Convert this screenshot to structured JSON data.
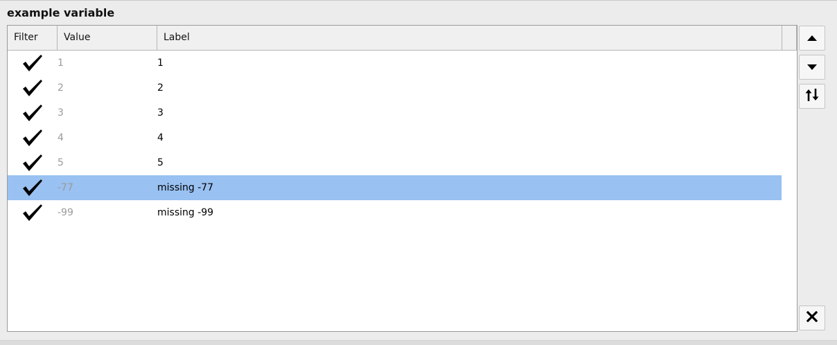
{
  "title": "example variable",
  "table": {
    "columns": [
      "Filter",
      "Value",
      "Label"
    ],
    "rows": [
      {
        "filter": true,
        "value": "1",
        "label": "1",
        "selected": false
      },
      {
        "filter": true,
        "value": "2",
        "label": "2",
        "selected": false
      },
      {
        "filter": true,
        "value": "3",
        "label": "3",
        "selected": false
      },
      {
        "filter": true,
        "value": "4",
        "label": "4",
        "selected": false
      },
      {
        "filter": true,
        "value": "5",
        "label": "5",
        "selected": false
      },
      {
        "filter": true,
        "value": "-77",
        "label": "missing -77",
        "selected": true
      },
      {
        "filter": true,
        "value": "-99",
        "label": "missing -99",
        "selected": false
      }
    ]
  },
  "buttons": {
    "move_up": "arrow-up-icon",
    "move_down": "arrow-down-icon",
    "reverse": "swap-vertical-icon",
    "clear": "close-icon"
  },
  "colors": {
    "selection": "#99c1f1",
    "value_text": "#9a9a9a"
  }
}
